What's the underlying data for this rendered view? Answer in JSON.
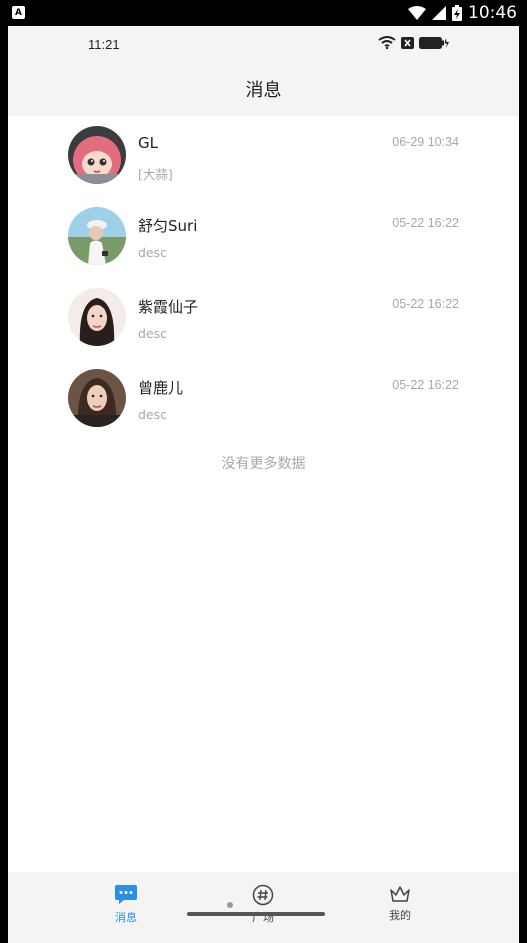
{
  "system_bar": {
    "time": "10:46",
    "notification_icon": "a-icon"
  },
  "inner_status": {
    "time": "11:21"
  },
  "header": {
    "title": "消息"
  },
  "messages": [
    {
      "name": "GL",
      "time": "06-29 10:34",
      "preview": "[大蒜]"
    },
    {
      "name": "舒匀Suri",
      "time": "05-22 16:22",
      "preview": "desc"
    },
    {
      "name": "紫霞仙子",
      "time": "05-22 16:22",
      "preview": "desc"
    },
    {
      "name": "曾鹿儿",
      "time": "05-22 16:22",
      "preview": "desc"
    }
  ],
  "list_footer": "没有更多数据",
  "tabs": [
    {
      "label": "消息",
      "icon": "chat-bubble-icon",
      "active": true
    },
    {
      "label": "广场",
      "icon": "hashtag-icon",
      "active": false
    },
    {
      "label": "我的",
      "icon": "crown-icon",
      "active": false
    }
  ],
  "colors": {
    "accent": "#2a8ee8",
    "secondary_text": "#a8a8a8",
    "header_bg": "#f4f4f4"
  }
}
